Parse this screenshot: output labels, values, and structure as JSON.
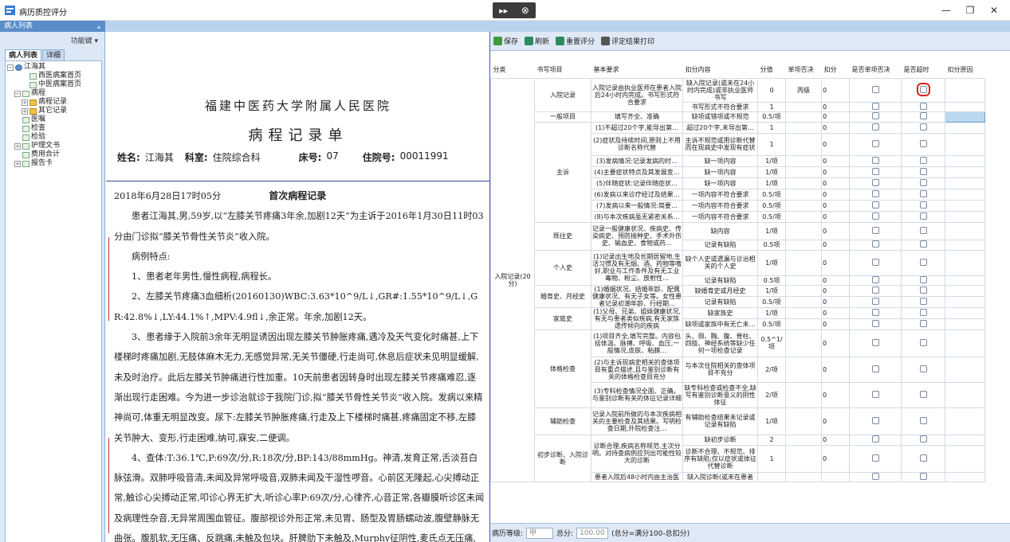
{
  "window": {
    "title": "病历质控评分",
    "minimize": "—",
    "restore": "❐",
    "close": "✕"
  },
  "left": {
    "header": "病人列表",
    "func_key": "功能键 ▾",
    "tabs": [
      "病人列表",
      "详细"
    ],
    "tree": [
      {
        "label": "江海其",
        "level": 0,
        "toggle": "−",
        "icon": "user"
      },
      {
        "label": "西医病案首页",
        "level": 2,
        "toggle": "",
        "icon": "doc"
      },
      {
        "label": "中医病案首页",
        "level": 2,
        "toggle": "",
        "icon": "doc"
      },
      {
        "label": "病程",
        "level": 1,
        "toggle": "−",
        "icon": "doc"
      },
      {
        "label": "病程记录",
        "level": 2,
        "toggle": "+",
        "icon": "folder"
      },
      {
        "label": "其它记录",
        "level": 2,
        "toggle": "+",
        "icon": "folder"
      },
      {
        "label": "医嘱",
        "level": 1,
        "toggle": "",
        "icon": "doc"
      },
      {
        "label": "检查",
        "level": 1,
        "toggle": "",
        "icon": "doc"
      },
      {
        "label": "检验",
        "level": 1,
        "toggle": "",
        "icon": "doc"
      },
      {
        "label": "护理文书",
        "level": 1,
        "toggle": "+",
        "icon": "doc"
      },
      {
        "label": "费用合计",
        "level": 1,
        "toggle": "",
        "icon": "doc"
      },
      {
        "label": "报告卡",
        "level": 1,
        "toggle": "+",
        "icon": "doc"
      }
    ]
  },
  "doc": {
    "hospital": "福建中医药大学附属人民医院",
    "title": "病程记录单",
    "patient": [
      {
        "label": "姓名:",
        "value": "江海其"
      },
      {
        "label": "科室:",
        "value": "住院综合科"
      },
      {
        "label": "床号:",
        "value": "07"
      },
      {
        "label": "住院号:",
        "value": "00011991"
      }
    ],
    "datetime": "2018年6月28日17时05分",
    "record_title": "首次病程记录",
    "paragraphs": [
      "患者江海其,男,59岁,以“左膝关节疼痛3年余,加剧12天”为主诉于2016年1月30日11时03分由门诊拟“膝关节骨性关节炎”收入院。",
      "病例特点:",
      "1、患者老年男性,慢性病程,病程长。",
      "2、左膝关节疼痛3血细析(20160130)WBC:3.63*10^9/L↓,GR#:1.55*10^9/L↓,GR:42.8%↓,LY:44.1%↑,MPV:4.9fl↓,余正常。年余,加剧12天。",
      "3、患者缘于入院前3余年无明显诱因出现左膝关节肿胀疼痛,遇冷及天气变化时痛甚,上下楼梯时疼痛加剧,无肢体麻木无力,无感觉异常,无关节僵硬,行走尚可,休息后症状未见明显缓解,未及时治疗。此后左膝关节肿痛进行性加重。10天前患者因转身时出现左膝关节疼痛难忍,逐渐出现行走困难。今为进一步诊治就诊于我院门诊,拟“膝关节骨性关节炎”收入院。发病以来精神尚可,体重无明显改变。尿下:左膝关节肿胀疼痛,行走及上下楼梯时痛甚,疼痛固定不移,左膝关节肿大、变形,行走困难,纳可,寐安,二便调。",
      "4、查体:T:36.1℃,P:69次/分,R:18次/分,BP:143/88mmHg。神清,发育正常,舌淡苔白脉弦滑。双肺呼吸音清,未闻及异常呼吸音,双肺未闻及干湿性啰音。心前区无隆起,心尖搏动正常,触诊心尖搏动正常,叩诊心界无扩大,听诊心率P:69次/分,心律齐,心音正常,各瓣膜听诊区未闻及病理性杂音,无异常周围血管征。腹部视诊外形正常,未见胃、肠型及胃肠蠕动波,腹壁静脉无曲张。腹肌软,无压痛、反跳痛,未触及包块。肝脾肋下未触及,Murphy征阴性,麦氏点无压痛,各输尿管压痛点"
    ]
  },
  "toolbar": {
    "save": "保存",
    "refresh": "刷新",
    "reset": "重置评分",
    "print": "评定结果打印"
  },
  "grid": {
    "headers": [
      "分类",
      "书写项目",
      "基本要求",
      "扣分内容",
      "分值",
      "单项否决",
      "扣分",
      "是否单项否决",
      "是否超时",
      "扣分原因"
    ],
    "category": "入院记录(20分)",
    "rows": [
      {
        "item": "入院记录",
        "req": "入院记录由执业医师在患者入院后24小时内完成。书写形式符合要求",
        "ded": "缺入院记录(或未在24小时内完成)或非执业医师书写",
        "score": "0",
        "veto": "丙级",
        "kou": "0",
        "h": 30
      },
      {
        "item": "",
        "req": "",
        "ded": "书写形式不符合要求",
        "score": "1",
        "veto": "",
        "kou": "0",
        "h": 11
      },
      {
        "item": "一般项目",
        "req": "填写齐全、准确",
        "ded": "缺项或错项或不规范",
        "score": "0.5/项",
        "veto": "",
        "kou": "0",
        "h": 13
      },
      {
        "item": "主诉",
        "req": "(1)不超过20个字,能导出第…",
        "ded": "超过20个字,未导出第…",
        "score": "1",
        "veto": "",
        "kou": "0",
        "h": 14
      },
      {
        "item": "",
        "req": "(2)症状及持续时间,原则上不用诊断名称代替",
        "ded": "主诉不规范或用诊断代替而在现病史中发现有症状",
        "score": "1",
        "veto": "",
        "kou": "0",
        "h": 28
      },
      {
        "item": "",
        "req": "(3)发病情况:记录发病的时…",
        "ded": "缺一项内容",
        "score": "1/项",
        "veto": "",
        "kou": "0",
        "h": 14
      },
      {
        "item": "",
        "req": "(4)主要症状特点及其发展变…",
        "ded": "缺一项内容",
        "score": "1/项",
        "veto": "",
        "kou": "0",
        "h": 14
      },
      {
        "item": "",
        "req": "(5)伴随症状:记录伴随症状…",
        "ded": "缺一项内容",
        "score": "1/项",
        "veto": "",
        "kou": "0",
        "h": 14
      },
      {
        "item": "",
        "req": "(6)发病以来诊疗经过及结果…",
        "ded": "一项内容不符合要求",
        "score": "0.5/项",
        "veto": "",
        "kou": "0",
        "h": 14
      },
      {
        "item": "",
        "req": "(7)发病以来一般情况:简要…",
        "ded": "一项内容不符合要求",
        "score": "0.5/项",
        "veto": "",
        "kou": "0",
        "h": 14
      },
      {
        "item": "",
        "req": "(8)与本次疾病虽无紧密关系…",
        "ded": "一项内容不符合要求",
        "score": "0.5/项",
        "veto": "",
        "kou": "0",
        "h": 14
      },
      {
        "item": "既往史",
        "req": "记录一般健康状况、疾病史、传染病史、预防接种史、手术外伤史、输血史、食物或药…",
        "ded": "缺内容",
        "score": "1/项",
        "veto": "",
        "kou": "0",
        "h": 22
      },
      {
        "item": "",
        "req": "",
        "ded": "记录有缺陷",
        "score": "0.5项",
        "veto": "",
        "kou": "0",
        "h": 13
      },
      {
        "item": "个人史",
        "req": "(1)记录出生地及长期居留地,生活习惯及有无烟、酒、药物等嗜好,职业与工作条件及有无工业毒物、粉尘、放射性…",
        "ded": "缺个人史或遗漏与诊治相关的个人史",
        "score": "1/项",
        "veto": "",
        "kou": "0",
        "h": 32
      },
      {
        "item": "",
        "req": "",
        "ded": "记录有缺陷",
        "score": "0.5项",
        "veto": "",
        "kou": "0",
        "h": 12
      },
      {
        "item": "婚育史、月经史",
        "req": "(1)婚姻状况、结婚年龄、配偶健康状况、有无子女等。女性患者记录初潮年龄、行经期…",
        "ded": "缺婚育史或月经史",
        "score": "1/项",
        "veto": "",
        "kou": "0",
        "h": 13
      },
      {
        "item": "",
        "req": "",
        "ded": "记录有缺陷",
        "score": "0.5/项",
        "veto": "",
        "kou": "0",
        "h": 13
      },
      {
        "item": "家庭史",
        "req": "(1)父母、兄弟、姐妹健康状况,有无与患者类似疾病,有无家族遗传倾向的疾病",
        "ded": "缺家族史",
        "score": "1/项",
        "veto": "",
        "kou": "0",
        "h": 13
      },
      {
        "item": "",
        "req": "",
        "ded": "缺项或家族中有无亡未…",
        "score": "0.5/项",
        "veto": "",
        "kou": "0",
        "h": 13
      },
      {
        "item": "体格检查",
        "req": "(1)项目齐全,填写完整。内容包括体温、脉搏、呼吸、血压,一般情况,皮肤、粘膜…",
        "ded": "头、颈、胸、腹、脊柱、四肢、神经系统等缺少任何一项检查记录",
        "score": "0.5^1/项",
        "veto": "",
        "kou": "0",
        "h": 34
      },
      {
        "item": "",
        "req": "(2)与主诉现病史相关的查体项目有重点描述,且与鉴别诊断有关的体格检查目充分",
        "ded": "与本次住院相关的查体项目不充分",
        "score": "2/项",
        "veto": "",
        "kou": "0",
        "h": 32
      },
      {
        "item": "",
        "req": "(3)专科检查情况全面、正确。与鉴别诊断有关的体征记录详细",
        "ded": "缺专科检查或检查不全,缺写有鉴别诊断意义的阴性体征",
        "score": "2/项",
        "veto": "",
        "kou": "0",
        "h": 32
      },
      {
        "item": "辅助检查",
        "req": "记录入院前所做的与本次疾病相关的主要检查及其结果。写明检查日期,外院检查注…",
        "ded": "有辅助检查结果未记录或记录有缺陷",
        "score": "1/项",
        "veto": "",
        "kou": "0",
        "h": 34
      },
      {
        "item": "初步诊断、入院诊断",
        "req": "诊断合理,疾病名称规范,主次分明。对待查病例应列出可能性较大的诊断",
        "ded": "缺初步诊断",
        "score": "2",
        "veto": "",
        "kou": "0",
        "h": 13
      },
      {
        "item": "",
        "req": "",
        "ded": "诊断不合理、不规范、排序有缺陷;仅以症状或体征代替诊断",
        "score": "1",
        "veto": "",
        "kou": "0",
        "h": 34
      },
      {
        "item": "",
        "req": "患者入院后48小时内由主治医",
        "ded": "缺入院诊断(或未在患者",
        "score": "",
        "veto": "",
        "kou": "",
        "h": 10
      }
    ]
  },
  "status": {
    "grade_label": "病历等级:",
    "grade_value": "甲",
    "total_label": "总分:",
    "total_value": "100.00",
    "formula": "(总分=满分100-总扣分)"
  }
}
